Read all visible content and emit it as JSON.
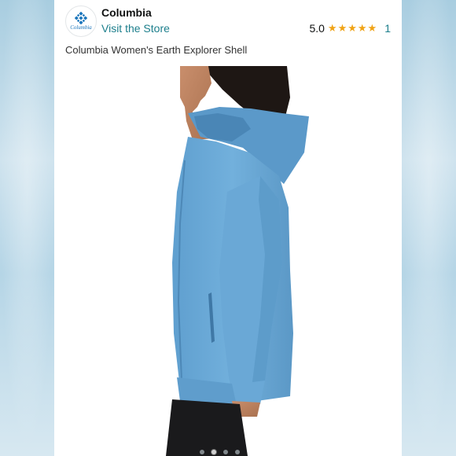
{
  "store": {
    "name": "Columbia",
    "logo_text": "Columbia",
    "visit_label": "Visit the Store"
  },
  "rating": {
    "score": "5.0",
    "stars": 5,
    "count": "1",
    "star_color": "#f0a316"
  },
  "product": {
    "title": "Columbia Women's Earth Explorer Shell",
    "jacket_color": "#6aa8d6"
  },
  "carousel": {
    "total": 4,
    "active_index": 1
  },
  "colors": {
    "link": "#1d7f8c",
    "brand_blue": "#1a75bb"
  }
}
